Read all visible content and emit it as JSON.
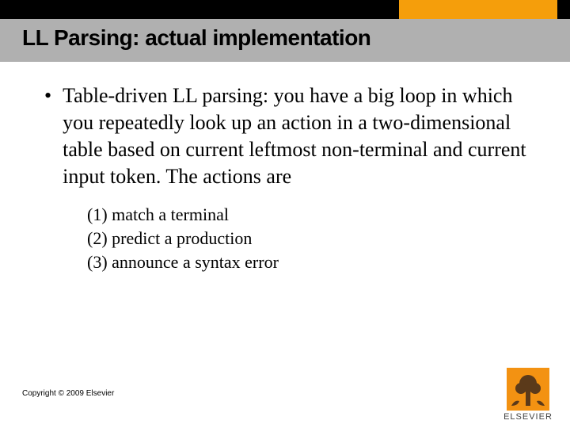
{
  "slide": {
    "title": "LL Parsing: actual implementation",
    "bullet_text": "Table-driven LL parsing:  you have a big loop in which you repeatedly look up an action in a two-dimensional table based on current leftmost non-terminal and current input token.  The actions are",
    "sublist": [
      "(1) match a terminal",
      "(2) predict a production",
      "(3) announce a syntax error"
    ],
    "copyright": "Copyright © 2009 Elsevier",
    "publisher_name": "ELSEVIER"
  }
}
